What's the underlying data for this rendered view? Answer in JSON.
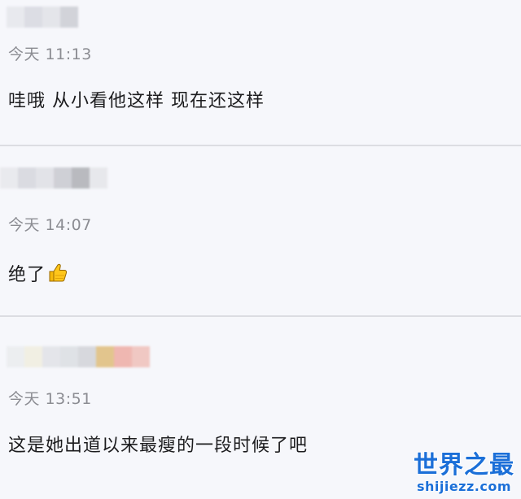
{
  "comments": [
    {
      "time": "今天 11:13",
      "text": "哇哦 从小看他这样 现在还这样",
      "name_blur_colors": [
        "#e8e9ee",
        "#dcdde4",
        "#e4e5ea",
        "#d2d3d9"
      ]
    },
    {
      "time": "今天 14:07",
      "text": "绝了",
      "emoji": "thumbs-up",
      "name_blur_colors": [
        "#e9eaee",
        "#dadbe1",
        "#e2e3e8",
        "#cfd0d6",
        "#b9babf",
        "#e7e8ec"
      ]
    },
    {
      "time": "今天 13:51",
      "text": "这是她出道以来最瘦的一段时候了吧",
      "name_blur_colors": [
        "#eceef0",
        "#f1efe3",
        "#e4e5ea",
        "#dfe2e6",
        "#d7d8dd",
        "#e2c58d",
        "#efb7b1",
        "#f0c8c3"
      ]
    }
  ],
  "watermark": {
    "title": "世界之最",
    "url": "shijiezz.com",
    "color": "#1b6fd8"
  }
}
